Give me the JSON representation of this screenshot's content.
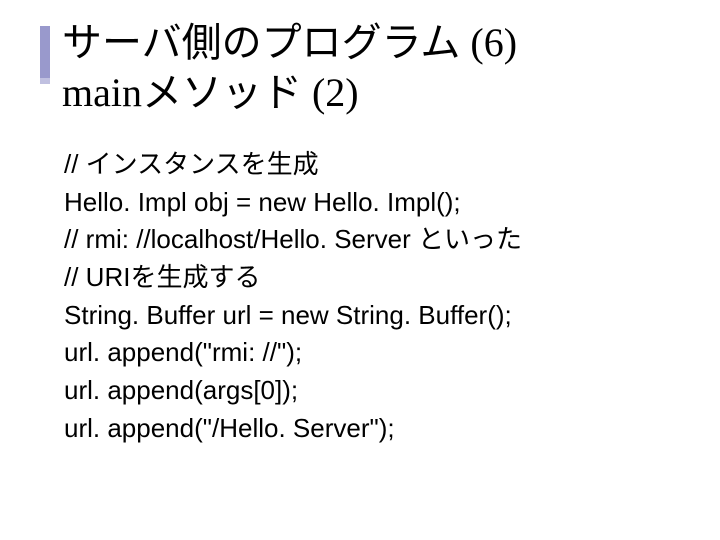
{
  "title": {
    "line1": "サーバ側のプログラム (6)",
    "line2": "mainメソッド (2)"
  },
  "code": {
    "l1": "// インスタンスを生成",
    "l2": "Hello. Impl obj = new Hello. Impl();",
    "l3": "// rmi: //localhost/Hello. Server といった",
    "l4": "// URIを生成する",
    "l5": "String. Buffer url = new String. Buffer();",
    "l6": "url. append(\"rmi: //\");",
    "l7": "url. append(args[0]);",
    "l8": "url. append(\"/Hello. Server\");"
  }
}
